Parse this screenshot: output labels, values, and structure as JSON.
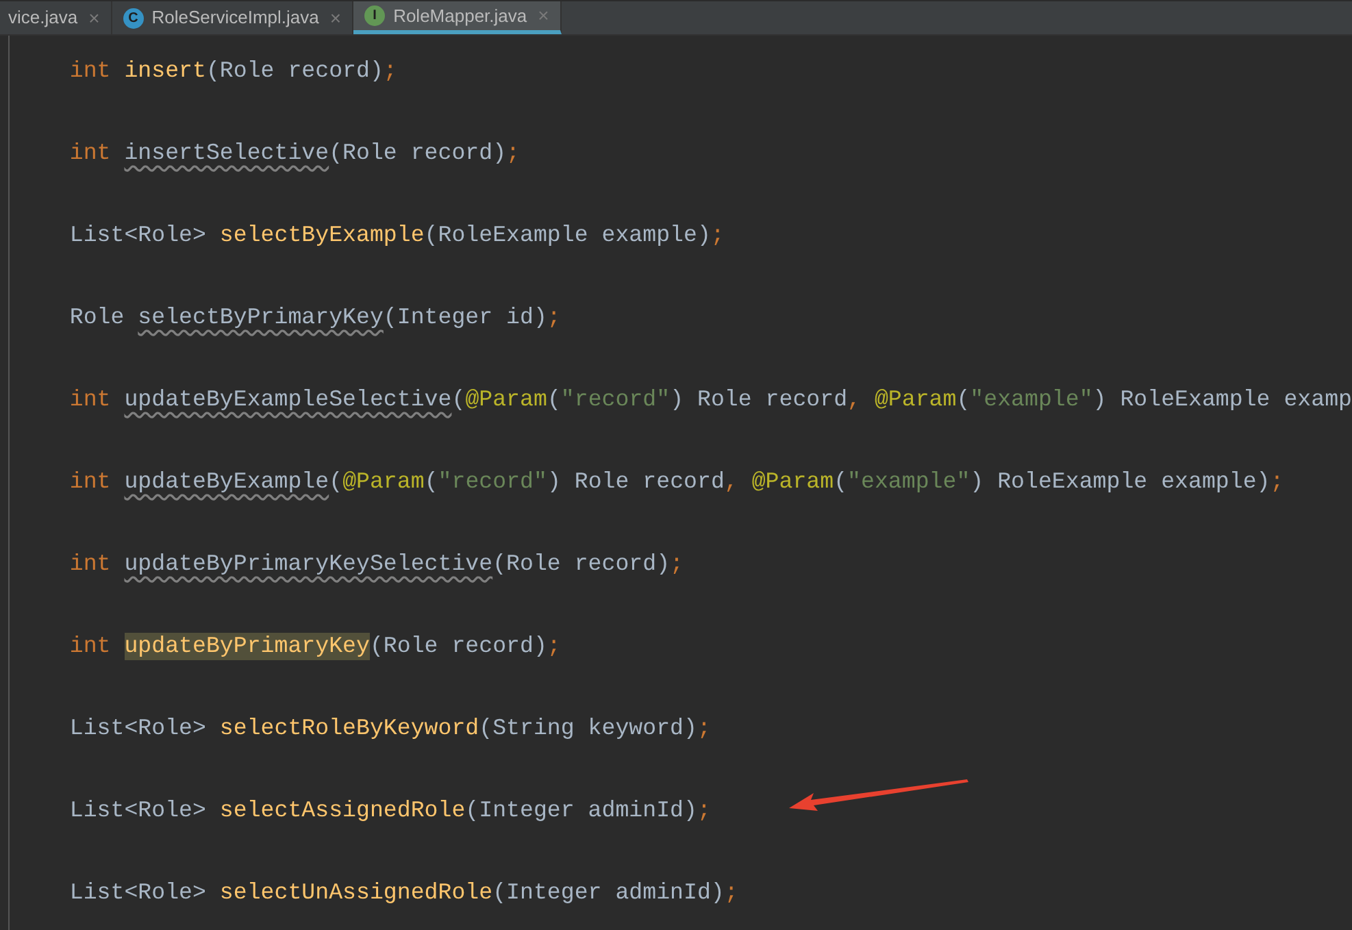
{
  "tabs": [
    {
      "label": "vice.java",
      "kind": "none",
      "selected": false
    },
    {
      "label": "RoleServiceImpl.java",
      "kind": "class",
      "icon_letter": "C",
      "selected": false
    },
    {
      "label": "RoleMapper.java",
      "kind": "interface",
      "icon_letter": "I",
      "selected": true
    }
  ],
  "close_glyph": "×",
  "code_lines": [
    [
      {
        "text": "int ",
        "kind": "keyword"
      },
      {
        "text": "insert",
        "kind": "method"
      },
      {
        "text": "(Role record)",
        "kind": "plain"
      },
      {
        "text": ";",
        "kind": "keyword"
      }
    ],
    [
      {
        "text": "int ",
        "kind": "keyword"
      },
      {
        "text": "insertSelective",
        "kind": "unused"
      },
      {
        "text": "(Role record)",
        "kind": "plain"
      },
      {
        "text": ";",
        "kind": "keyword"
      }
    ],
    [
      {
        "text": "List<Role> ",
        "kind": "plain"
      },
      {
        "text": "selectByExample",
        "kind": "method"
      },
      {
        "text": "(RoleExample example)",
        "kind": "plain"
      },
      {
        "text": ";",
        "kind": "keyword"
      }
    ],
    [
      {
        "text": "Role ",
        "kind": "plain"
      },
      {
        "text": "selectByPrimaryKey",
        "kind": "unused"
      },
      {
        "text": "(Integer id)",
        "kind": "plain"
      },
      {
        "text": ";",
        "kind": "keyword"
      }
    ],
    [
      {
        "text": "int ",
        "kind": "keyword"
      },
      {
        "text": "updateByExampleSelective",
        "kind": "unused"
      },
      {
        "text": "(",
        "kind": "plain"
      },
      {
        "text": "@Param",
        "kind": "annotation"
      },
      {
        "text": "(",
        "kind": "plain"
      },
      {
        "text": "\"record\"",
        "kind": "string"
      },
      {
        "text": ") Role record",
        "kind": "plain"
      },
      {
        "text": ", ",
        "kind": "keyword"
      },
      {
        "text": "@Param",
        "kind": "annotation"
      },
      {
        "text": "(",
        "kind": "plain"
      },
      {
        "text": "\"example\"",
        "kind": "string"
      },
      {
        "text": ") RoleExample examp",
        "kind": "plain"
      }
    ],
    [
      {
        "text": "int ",
        "kind": "keyword"
      },
      {
        "text": "updateByExample",
        "kind": "unused"
      },
      {
        "text": "(",
        "kind": "plain"
      },
      {
        "text": "@Param",
        "kind": "annotation"
      },
      {
        "text": "(",
        "kind": "plain"
      },
      {
        "text": "\"record\"",
        "kind": "string"
      },
      {
        "text": ") Role record",
        "kind": "plain"
      },
      {
        "text": ", ",
        "kind": "keyword"
      },
      {
        "text": "@Param",
        "kind": "annotation"
      },
      {
        "text": "(",
        "kind": "plain"
      },
      {
        "text": "\"example\"",
        "kind": "string"
      },
      {
        "text": ") RoleExample example)",
        "kind": "plain"
      },
      {
        "text": ";",
        "kind": "keyword"
      }
    ],
    [
      {
        "text": "int ",
        "kind": "keyword"
      },
      {
        "text": "updateByPrimaryKeySelective",
        "kind": "unused"
      },
      {
        "text": "(Role record)",
        "kind": "plain"
      },
      {
        "text": ";",
        "kind": "keyword"
      }
    ],
    [
      {
        "text": "int ",
        "kind": "keyword"
      },
      {
        "text": "updateByPrimaryKey",
        "kind": "highlighted"
      },
      {
        "text": "(Role record)",
        "kind": "plain"
      },
      {
        "text": ";",
        "kind": "keyword"
      }
    ],
    [
      {
        "text": "List<Role> ",
        "kind": "plain"
      },
      {
        "text": "selectRoleByKeyword",
        "kind": "method"
      },
      {
        "text": "(String keyword)",
        "kind": "plain"
      },
      {
        "text": ";",
        "kind": "keyword"
      }
    ],
    [
      {
        "text": "List<Role> ",
        "kind": "plain"
      },
      {
        "text": "selectAssignedRole",
        "kind": "method"
      },
      {
        "text": "(Integer adminId)",
        "kind": "plain"
      },
      {
        "text": ";",
        "kind": "keyword"
      }
    ],
    [
      {
        "text": "List<Role> ",
        "kind": "plain"
      },
      {
        "text": "selectUnAssignedRole",
        "kind": "method"
      },
      {
        "text": "(Integer adminId)",
        "kind": "plain"
      },
      {
        "text": ";",
        "kind": "keyword"
      }
    ]
  ]
}
